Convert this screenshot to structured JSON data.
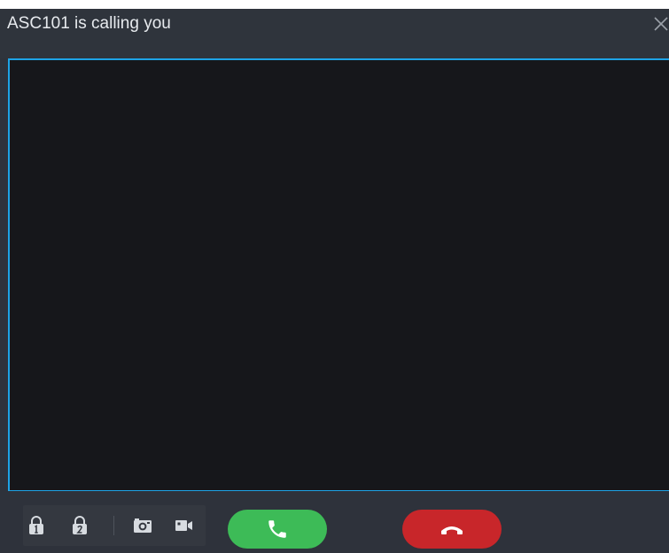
{
  "window": {
    "title": "ASC101 is calling you"
  },
  "titlebar": {
    "close_icon": "close-icon"
  },
  "toolbar": {
    "tools": [
      {
        "name": "unlock-door-1",
        "icon": "lock-1-icon"
      },
      {
        "name": "unlock-door-2",
        "icon": "lock-2-icon"
      },
      {
        "name": "snapshot",
        "icon": "camera-icon"
      },
      {
        "name": "record",
        "icon": "video-camera-icon"
      }
    ],
    "accept_icon": "phone-icon",
    "hangup_icon": "phone-hangup-icon"
  },
  "colors": {
    "window_bg": "#2e323b",
    "video_bg": "#16171b",
    "video_border": "#1ea3e6",
    "accept": "#3dbb57",
    "hangup": "#c8262a",
    "icon": "#d7dbe0",
    "title_text": "#e7eaee"
  }
}
